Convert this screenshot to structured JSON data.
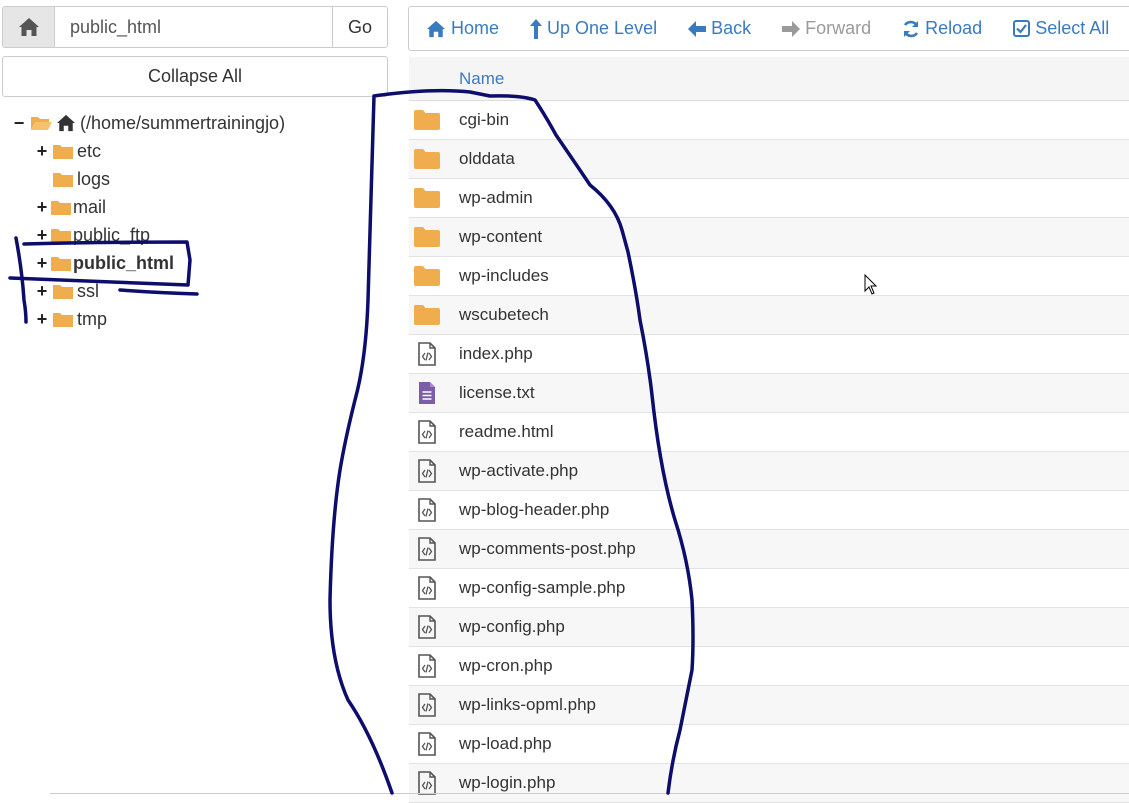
{
  "path_bar": {
    "value": "public_html",
    "go_label": "Go"
  },
  "collapse_label": "Collapse All",
  "tree": {
    "root": "(/home/summertrainingjo)",
    "items": [
      {
        "label": "etc",
        "expander": "+"
      },
      {
        "label": "logs",
        "expander": ""
      },
      {
        "label": "mail",
        "expander": "+"
      },
      {
        "label": "public_ftp",
        "expander": "+"
      },
      {
        "label": "public_html",
        "expander": "+",
        "selected": true
      },
      {
        "label": "ssl",
        "expander": "+"
      },
      {
        "label": "tmp",
        "expander": "+"
      }
    ],
    "root_expander": "−"
  },
  "toolbar": {
    "home": "Home",
    "up": "Up One Level",
    "back": "Back",
    "forward": "Forward",
    "reload": "Reload",
    "select_all": "Select All"
  },
  "table": {
    "column_name": "Name",
    "rows": [
      {
        "name": "cgi-bin",
        "type": "folder"
      },
      {
        "name": "olddata",
        "type": "folder"
      },
      {
        "name": "wp-admin",
        "type": "folder"
      },
      {
        "name": "wp-content",
        "type": "folder"
      },
      {
        "name": "wp-includes",
        "type": "folder"
      },
      {
        "name": "wscubetech",
        "type": "folder"
      },
      {
        "name": "index.php",
        "type": "code"
      },
      {
        "name": "license.txt",
        "type": "text"
      },
      {
        "name": "readme.html",
        "type": "code"
      },
      {
        "name": "wp-activate.php",
        "type": "code"
      },
      {
        "name": "wp-blog-header.php",
        "type": "code"
      },
      {
        "name": "wp-comments-post.php",
        "type": "code"
      },
      {
        "name": "wp-config-sample.php",
        "type": "code"
      },
      {
        "name": "wp-config.php",
        "type": "code"
      },
      {
        "name": "wp-cron.php",
        "type": "code"
      },
      {
        "name": "wp-links-opml.php",
        "type": "code"
      },
      {
        "name": "wp-load.php",
        "type": "code"
      },
      {
        "name": "wp-login.php",
        "type": "code"
      }
    ]
  },
  "colors": {
    "accent": "#3a7bc0",
    "folder": "#f0ad4e",
    "annotation": "#0d0d6b",
    "text_file": "#7b5ea7"
  }
}
